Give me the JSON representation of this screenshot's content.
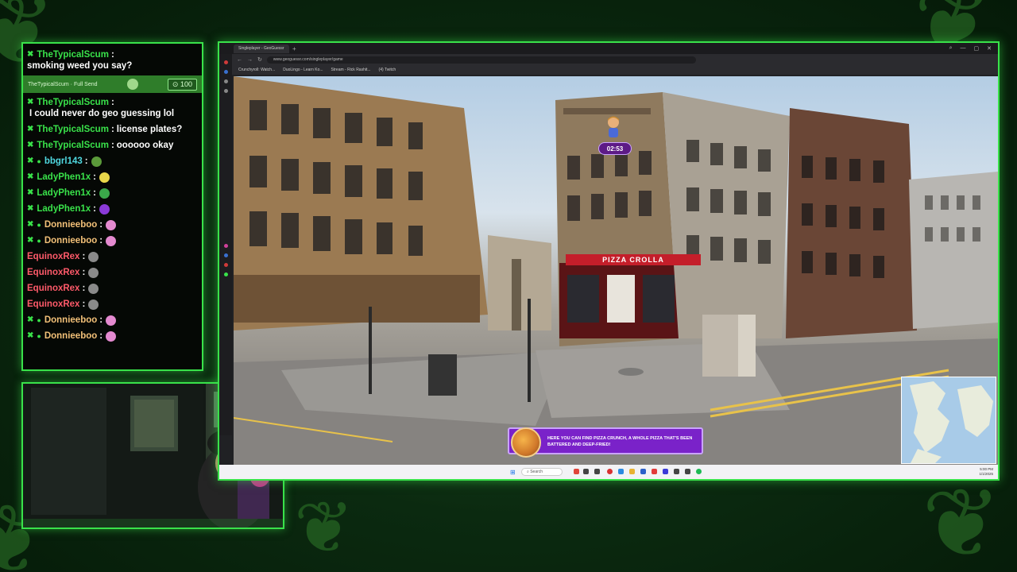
{
  "chat": {
    "pinned_message": {
      "user": "TheTypicalScum",
      "text": "smoking weed you say?"
    },
    "highlight": {
      "label": "TheTypicalScum · Full Send",
      "points": "100"
    },
    "messages": [
      {
        "user": "TheTypicalScum",
        "text": "I could never do geo guessing lol",
        "color": "#39e24a",
        "badge": "k"
      },
      {
        "user": "TheTypicalScum",
        "text": "license plates?",
        "color": "#39e24a",
        "badge": "k"
      },
      {
        "user": "TheTypicalScum",
        "text": "oooooo okay",
        "color": "#39e24a",
        "badge": "k"
      },
      {
        "user": "bbgrl143",
        "text": "",
        "color": "#4fd8e0",
        "badge": "k-dot",
        "emote": "#5b9b3a"
      },
      {
        "user": "LadyPhen1x",
        "text": "",
        "color": "#39e24a",
        "badge": "k",
        "emote": "#e9d84a"
      },
      {
        "user": "LadyPhen1x",
        "text": "",
        "color": "#39e24a",
        "badge": "k",
        "emote": "#3aa84a"
      },
      {
        "user": "LadyPhen1x",
        "text": "",
        "color": "#39e24a",
        "badge": "k",
        "emote": "#8a3ad8"
      },
      {
        "user": "Donnieeboo",
        "text": "",
        "color": "#f2c078",
        "badge": "k-dot",
        "emote": "#e48ad0"
      },
      {
        "user": "Donnieeboo",
        "text": "",
        "color": "#f2c078",
        "badge": "k-dot",
        "emote": "#e48ad0"
      },
      {
        "user": "EquinoxRex",
        "text": "",
        "color": "#ff5a6a",
        "badge": "none",
        "emote": "#8a8a8a"
      },
      {
        "user": "EquinoxRex",
        "text": "",
        "color": "#ff5a6a",
        "badge": "none",
        "emote": "#8a8a8a"
      },
      {
        "user": "EquinoxRex",
        "text": "",
        "color": "#ff5a6a",
        "badge": "none",
        "emote": "#8a8a8a"
      },
      {
        "user": "EquinoxRex",
        "text": "",
        "color": "#ff5a6a",
        "badge": "none",
        "emote": "#8a8a8a"
      },
      {
        "user": "Donnieeboo",
        "text": "",
        "color": "#f2c078",
        "badge": "k-dot",
        "emote": "#e48ad0"
      },
      {
        "user": "Donnieeboo",
        "text": "",
        "color": "#f2c078",
        "badge": "k-dot",
        "emote": "#e48ad0"
      }
    ]
  },
  "browser": {
    "tab_title": "Singleplayer - GeoGuessr",
    "url": "www.geoguessr.com/singleplayer/game",
    "bookmarks": [
      "Crunchyroll: Watch...",
      "DuoLingo - Learn Ko...",
      "Stream - Rick Rashit...",
      "(4) Twitch"
    ]
  },
  "game": {
    "timer": "02:53",
    "shop_sign": "PIZZA CROLLA",
    "toast": "HERE YOU CAN FIND PIZZA CRUNCH, A WHOLE PIZZA THAT'S BEEN BATTERED AND DEEP-FRIED!"
  },
  "taskbar": {
    "search_placeholder": "Search",
    "time": "5:00 PM",
    "date": "1/1/2025"
  },
  "colors": {
    "accent": "#39e24a",
    "purple": "#7a22c9"
  }
}
